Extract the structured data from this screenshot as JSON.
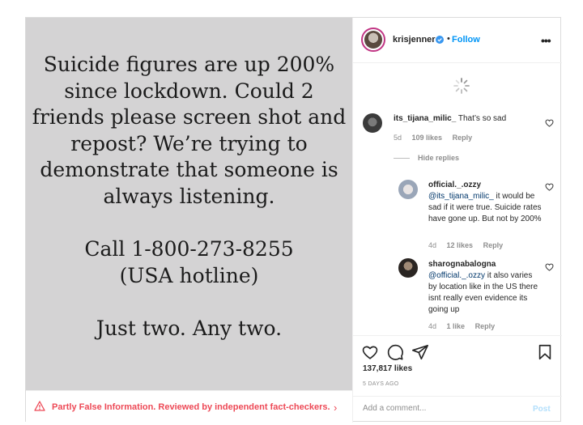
{
  "post": {
    "story_lines_1": [
      "Suicide figures are up 200%",
      "since lockdown. Could 2",
      "friends please screen shot and",
      "repost? We’re trying to",
      "demonstrate that someone is",
      "always listening."
    ],
    "story_lines_2": [
      "Call 1-800-273-8255",
      "(USA hotline)"
    ],
    "story_lines_3": [
      "Just two. Any two."
    ],
    "warning_text": "Partly False Information. Reviewed by independent fact-checkers.",
    "warning_color": "#ed4956"
  },
  "header": {
    "username": "krisjenner",
    "separator": "•",
    "follow_label": "Follow",
    "accent_color": "#0095f6"
  },
  "comments": [
    {
      "username": "its_tijana_milic_",
      "text": "That’s so sad",
      "age": "5d",
      "likes": "109 likes",
      "reply_label": "Reply"
    }
  ],
  "hide_replies_label": "Hide replies",
  "replies": [
    {
      "username": "official._.ozzy",
      "mention": "@its_tijana_milic_",
      "text": " it would be sad if it were true. Suicide rates have gone up. But not by 200%",
      "age": "4d",
      "likes": "12 likes",
      "reply_label": "Reply"
    },
    {
      "username": "sharognabalogna",
      "mention": "@official._.ozzy",
      "text": " it also varies by location like in the US there isnt really even evidence its going up",
      "age": "4d",
      "likes": "1 like",
      "reply_label": "Reply"
    }
  ],
  "actions": {
    "likes_count": "137,817 likes",
    "date": "5 DAYS AGO",
    "comment_placeholder": "Add a comment...",
    "post_label": "Post"
  },
  "icons": {
    "warning": "warning-triangle-icon",
    "verified": "verified-badge-icon",
    "more": "more-options-icon",
    "heart": "heart-icon",
    "comment": "comment-icon",
    "share": "share-icon",
    "bookmark": "bookmark-icon"
  }
}
